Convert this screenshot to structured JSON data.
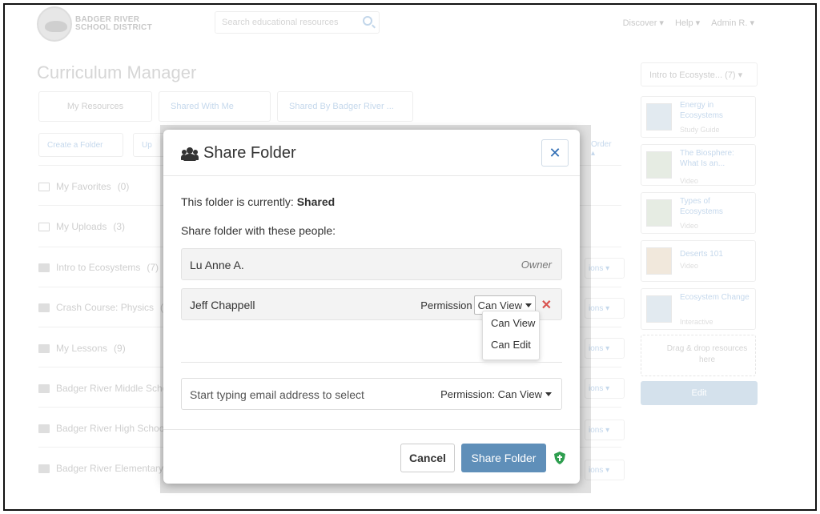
{
  "background": {
    "logo_text_line1": "BADGER RIVER",
    "logo_text_line2": "SCHOOL DISTRICT",
    "search_placeholder": "Search educational resources",
    "nav": [
      "Discover ▾",
      "Help ▾",
      "Admin R. ▾"
    ],
    "page_title": "Curriculum Manager",
    "tabs": [
      "My Resources",
      "Shared With Me",
      "Shared By Badger River ..."
    ],
    "actions": [
      "Create a Folder",
      "Up"
    ],
    "sort_label": "Order ▴",
    "folders": [
      {
        "label": "My Favorites",
        "count": "(0)"
      },
      {
        "label": "My Uploads",
        "count": "(3)"
      },
      {
        "label": "Intro to Ecosystems",
        "count": "(7)"
      },
      {
        "label": "Crash Course: Physics",
        "count": "(4"
      },
      {
        "label": "My Lessons",
        "count": "(9)"
      },
      {
        "label": "Badger River Middle Scho",
        "count": ""
      },
      {
        "label": "Badger River High School",
        "count": ""
      },
      {
        "label": "Badger River Elementary",
        "count": ""
      }
    ],
    "options_label": "ions ▾",
    "side_dropdown": "Intro to Ecosyste... (7) ▾",
    "side_cards": [
      {
        "title": "Energy in Ecosystems",
        "sub": "Study Guide"
      },
      {
        "title": "The Biosphere: What Is an...",
        "sub": "Video"
      },
      {
        "title": "Types of Ecosystems",
        "sub": "Video"
      },
      {
        "title": "Deserts 101",
        "sub": "Video"
      },
      {
        "title": "Ecosystem Change",
        "sub": "Interactive"
      }
    ],
    "drop_text": "Drag & drop resources here",
    "edit_label": "Edit"
  },
  "modal": {
    "title": "Share Folder",
    "close_label": "✕",
    "status_prefix": "This folder is currently:",
    "status_value": "Shared",
    "share_label": "Share folder with these people:",
    "people": [
      {
        "name": "Lu Anne A.",
        "role": "Owner"
      },
      {
        "name": "Jeff Chappell",
        "permission_label": "Permission",
        "permission_value": "Can View"
      }
    ],
    "dropdown_options": [
      "Can View",
      "Can Edit"
    ],
    "email_placeholder": "Start typing email address to select",
    "email_permission": "Permission: Can View",
    "cancel_label": "Cancel",
    "submit_label": "Share Folder"
  },
  "colors": {
    "accent": "#5f8fb9",
    "remove": "#d9534f",
    "shield": "#2e9e4f"
  }
}
